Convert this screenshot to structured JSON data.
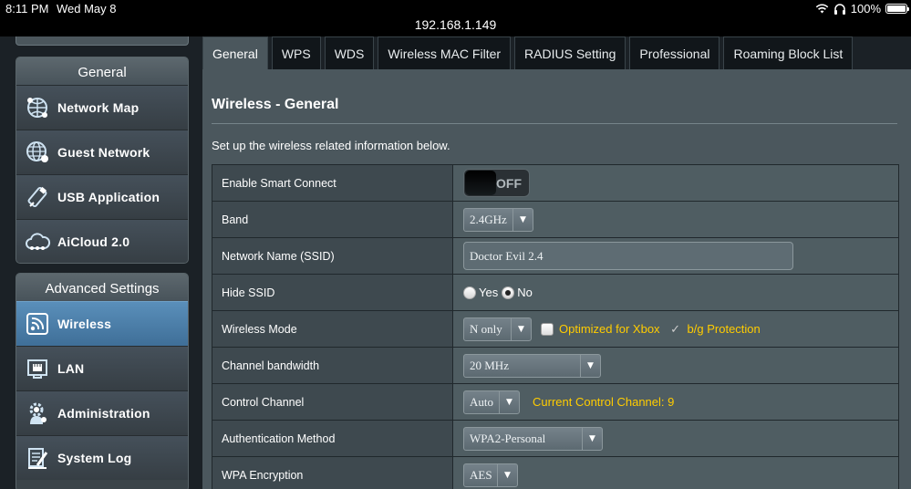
{
  "status_bar": {
    "time": "8:11 PM",
    "date": "Wed May 8",
    "battery": "100%",
    "battery_level": 1.0
  },
  "url": "192.168.1.149",
  "sidebar": {
    "general_title": "General",
    "general_items": [
      {
        "label": "Network Map",
        "icon": "network-map-icon"
      },
      {
        "label": "Guest Network",
        "icon": "globe-icon"
      },
      {
        "label": "USB Application",
        "icon": "usb-icon"
      },
      {
        "label": "AiCloud 2.0",
        "icon": "cloud-icon"
      }
    ],
    "advanced_title": "Advanced Settings",
    "advanced_items": [
      {
        "label": "Wireless",
        "icon": "wireless-icon",
        "active": true
      },
      {
        "label": "LAN",
        "icon": "lan-icon"
      },
      {
        "label": "Administration",
        "icon": "gear-person-icon"
      },
      {
        "label": "System Log",
        "icon": "log-icon"
      }
    ]
  },
  "tabs": [
    {
      "label": "General",
      "active": true
    },
    {
      "label": "WPS"
    },
    {
      "label": "WDS"
    },
    {
      "label": "Wireless MAC Filter"
    },
    {
      "label": "RADIUS Setting"
    },
    {
      "label": "Professional"
    },
    {
      "label": "Roaming Block List"
    }
  ],
  "main": {
    "title": "Wireless - General",
    "description": "Set up the wireless related information below.",
    "fields": {
      "smart_connect": {
        "label": "Enable Smart Connect",
        "value": "OFF"
      },
      "band": {
        "label": "Band",
        "value": "2.4GHz"
      },
      "ssid": {
        "label": "Network Name (SSID)",
        "value": "Doctor Evil 2.4"
      },
      "hide_ssid": {
        "label": "Hide SSID",
        "yes": "Yes",
        "no": "No",
        "selected": "No"
      },
      "wireless_mode": {
        "label": "Wireless Mode",
        "value": "N only",
        "xbox_label": "Optimized for Xbox",
        "bg_label": "b/g Protection"
      },
      "channel_bandwidth": {
        "label": "Channel bandwidth",
        "value": "20 MHz"
      },
      "control_channel": {
        "label": "Control Channel",
        "value": "Auto",
        "current": "Current Control Channel: 9"
      },
      "auth_method": {
        "label": "Authentication Method",
        "value": "WPA2-Personal"
      },
      "wpa_encryption": {
        "label": "WPA Encryption",
        "value": "AES"
      }
    }
  },
  "colors": {
    "active_menu": "#4a80ab",
    "accent_yellow": "#ffcc00",
    "panel": "#4b575d"
  }
}
